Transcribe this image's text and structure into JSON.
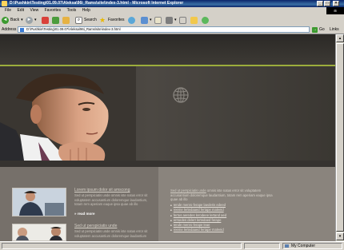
{
  "window": {
    "title": "D:\\Pushkin\\Testing\\01.09.07\\Aleksa\\96i_Rams\\site\\index-3.html - Microsoft Internet Explorer",
    "minimize": "_",
    "maximize": "□",
    "close": "×"
  },
  "menu": {
    "items": [
      "File",
      "Edit",
      "View",
      "Favorites",
      "Tools",
      "Help"
    ]
  },
  "toolbar": {
    "back_label": "Back",
    "search_label": "Search",
    "favorites_label": "Favorites"
  },
  "address": {
    "label": "Address",
    "value": "D:\\Pushkin\\Testing\\01.09.07\\Aleksa\\96i_Rams\\site\\index-3.html",
    "go_label": "Go",
    "links_label": "Links"
  },
  "page": {
    "left_article_1": {
      "title": "Lorem ipsum dolor sit amscong",
      "text": "Sed ut perspiciatis unde omnis iste natus error sit voluptatem accusantium doloremque laudantium, totam rem aperiam eaque ipsa quae ab illo",
      "read_more": "» read more"
    },
    "left_article_2": {
      "title": "Sed ut perspiciatis unde",
      "text": "Sed ut perspiciatis unde omnis iste natus error sit voluptatem accusantium doloremque laudantium"
    },
    "right_intro_link": "Sed ut perspiciatis unde",
    "right_intro_text": "omnis iste natus error sit voluptatem accusantium doloremque laudantium, totam rem aperiam eaque ipsa quae ab illo",
    "list_items": [
      "Iende menro ferape laederis edeed",
      "reeme lertedaaed fertape maleeid",
      "fertus aeredes lerodeee lertand aed",
      "errsedes delert lertedaed ferape",
      "Iende menro ferape leae",
      "reeme lertedaaed fertape maleeid"
    ]
  },
  "status": {
    "text": "My Computer"
  }
}
